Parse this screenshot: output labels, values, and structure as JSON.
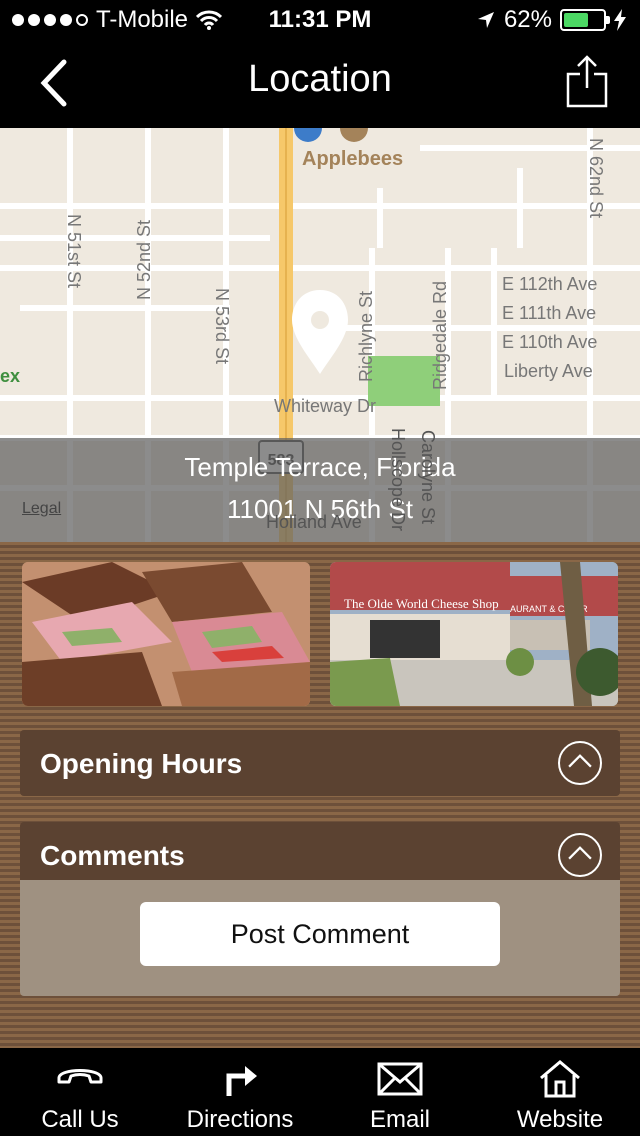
{
  "status_bar": {
    "carrier": "T-Mobile",
    "time": "11:31 PM",
    "battery": "62%",
    "battery_level": 0.62,
    "signal_bars": 4
  },
  "nav": {
    "title": "Location"
  },
  "map": {
    "street_labels": {
      "n51st": "N 51st St",
      "n52nd": "N 52nd St",
      "n53rd": "N 53rd St",
      "richlyne": "Richlyne St",
      "ridgedale": "Ridgedale Rd",
      "n62nd": "N 62nd St",
      "e112": "E 112th Ave",
      "e111": "E 111th Ave",
      "e110": "E 110th Ave",
      "liberty": "Liberty Ave",
      "whiteway": "Whiteway Dr",
      "holland": "Holland Ave",
      "carolyne": "Carolyne St",
      "hollscope": "Hollscope Dr",
      "ex": "ex"
    },
    "poi": "Applebees",
    "route_shield": "583",
    "legal": "Legal",
    "address_city": "Temple Terrace, Florida",
    "address_street": "11001 N 56th St",
    "colors": {
      "land": "#efe9df",
      "road": "#ffffff",
      "highway": "#f6c86a",
      "park": "#8fcf7a"
    }
  },
  "photos": [
    {
      "name": "sandwich-photo",
      "description_icon": "sandwich"
    },
    {
      "name": "storefront-photo",
      "sign_text": "The Olde World Cheese Shop",
      "side_sign": "AURANT & CATER"
    }
  ],
  "sections": {
    "opening_hours": "Opening Hours",
    "comments": "Comments",
    "post_comment": "Post Comment"
  },
  "tabs": [
    {
      "label": "Call Us",
      "icon": "phone-icon"
    },
    {
      "label": "Directions",
      "icon": "directions-icon"
    },
    {
      "label": "Email",
      "icon": "mail-icon"
    },
    {
      "label": "Website",
      "icon": "home-icon"
    }
  ]
}
